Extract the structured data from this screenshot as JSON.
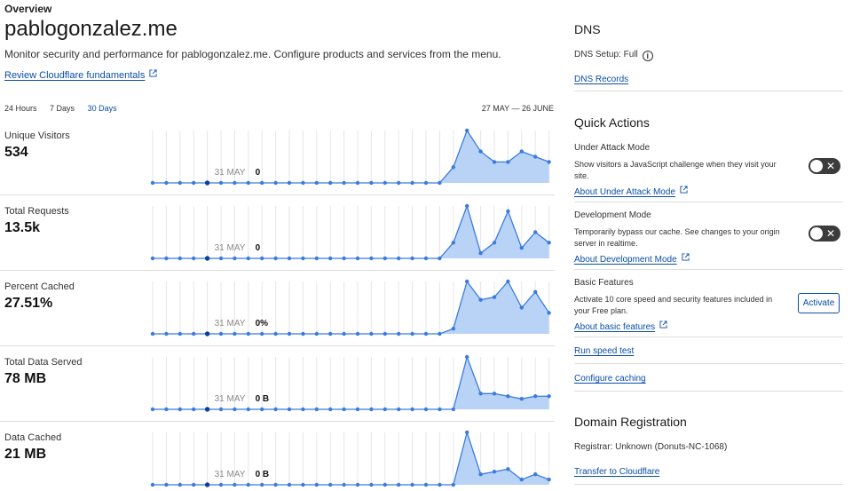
{
  "header": {
    "breadcrumb": "Overview",
    "title": "pablogonzalez.me",
    "description": "Monitor security and performance for pablogonzalez.me. Configure products and services from the menu.",
    "review_link": "Review Cloudflare fundamentals"
  },
  "time_range": {
    "options": [
      "24 Hours",
      "7 Days",
      "30 Days"
    ],
    "selected": "30 Days",
    "date_range": "27 MAY — 26 JUNE"
  },
  "colors": {
    "link": "#0a4ea8",
    "series_line": "#3a7be0",
    "series_fill": "#b9d3f7",
    "highlight_point": "#0a3f9a"
  },
  "chart_data": [
    {
      "type": "area",
      "title": "Unique Visitors",
      "summary": "534",
      "hover_label": "31 MAY",
      "hover_value": "0",
      "highlight_index": 4,
      "values": [
        0,
        0,
        0,
        0,
        0,
        0,
        0,
        0,
        0,
        0,
        0,
        0,
        0,
        0,
        0,
        0,
        0,
        0,
        0,
        0,
        0,
        0,
        3,
        10,
        6,
        4,
        4,
        6,
        5,
        4
      ]
    },
    {
      "type": "area",
      "title": "Total Requests",
      "summary": "13.5k",
      "hover_label": "31 MAY",
      "hover_value": "0",
      "highlight_index": 4,
      "values": [
        0,
        0,
        0,
        0,
        0,
        0,
        0,
        0,
        0,
        0,
        0,
        0,
        0,
        0,
        0,
        0,
        0,
        0,
        0,
        0,
        0,
        0,
        3,
        10,
        1,
        3,
        9,
        2,
        5,
        3
      ]
    },
    {
      "type": "area",
      "title": "Percent Cached",
      "summary": "27.51%",
      "hover_label": "31 MAY",
      "hover_value": "0%",
      "highlight_index": 4,
      "values": [
        0,
        0,
        0,
        0,
        0,
        0,
        0,
        0,
        0,
        0,
        0,
        0,
        0,
        0,
        0,
        0,
        0,
        0,
        0,
        0,
        0,
        0,
        1,
        10,
        6.5,
        7,
        10,
        5,
        8,
        4
      ]
    },
    {
      "type": "area",
      "title": "Total Data Served",
      "summary": "78 MB",
      "hover_label": "31 MAY",
      "hover_value": "0 B",
      "highlight_index": 4,
      "values": [
        0,
        0,
        0,
        0,
        0,
        0,
        0,
        0,
        0,
        0,
        0,
        0,
        0,
        0,
        0,
        0,
        0,
        0,
        0,
        0,
        0,
        0,
        0,
        10,
        3,
        3,
        2.5,
        2,
        2.5,
        2.5
      ]
    },
    {
      "type": "area",
      "title": "Data Cached",
      "summary": "21 MB",
      "hover_label": "31 MAY",
      "hover_value": "0 B",
      "highlight_index": 4,
      "values": [
        0,
        0,
        0,
        0,
        0,
        0,
        0,
        0,
        0,
        0,
        0,
        0,
        0,
        0,
        0,
        0,
        0,
        0,
        0,
        0,
        0,
        0,
        0,
        10,
        2,
        2.5,
        3,
        1,
        2,
        1
      ]
    }
  ],
  "dns": {
    "title": "DNS",
    "setup_label": "DNS Setup:",
    "setup_value": "Full",
    "records_link": "DNS Records"
  },
  "quick_actions": {
    "title": "Quick Actions",
    "under_attack": {
      "label": "Under Attack Mode",
      "description": "Show visitors a JavaScript challenge when they visit your site.",
      "link": "About Under Attack Mode"
    },
    "dev_mode": {
      "label": "Development Mode",
      "description": "Temporarily bypass our cache. See changes to your origin server in realtime.",
      "link": "About Development Mode"
    },
    "basic_features": {
      "label": "Basic Features",
      "description": "Activate 10 core speed and security features included in your Free plan.",
      "link": "About basic features",
      "button": "Activate"
    },
    "speed_test_link": "Run speed test",
    "caching_link": "Configure caching"
  },
  "domain_registration": {
    "title": "Domain Registration",
    "registrar": "Registrar: Unknown (Donuts-NC-1068)",
    "transfer_link": "Transfer to Cloudflare"
  }
}
